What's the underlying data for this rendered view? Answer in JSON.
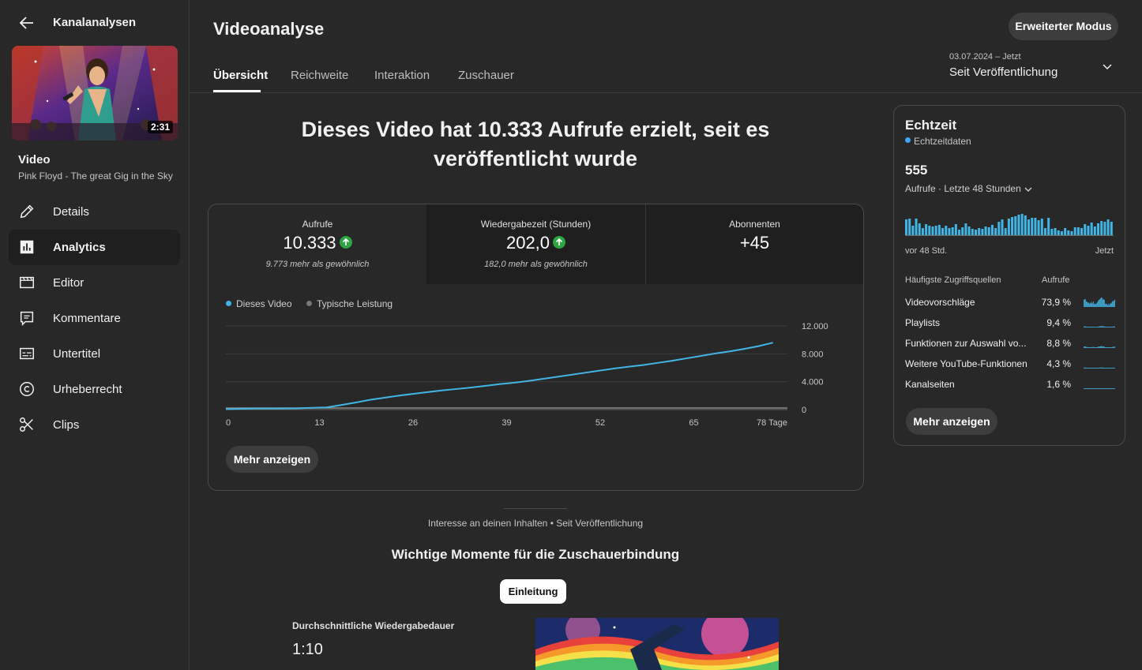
{
  "sidebar": {
    "title": "Kanalanalysen",
    "thumbnail_duration": "2:31",
    "video_label": "Video",
    "video_name": "Pink Floyd - The great Gig in the Sky ...",
    "items": [
      {
        "label": "Details",
        "icon": "pencil-icon"
      },
      {
        "label": "Analytics",
        "icon": "analytics-icon"
      },
      {
        "label": "Editor",
        "icon": "clapperboard-icon"
      },
      {
        "label": "Kommentare",
        "icon": "comment-icon"
      },
      {
        "label": "Untertitel",
        "icon": "subtitles-icon"
      },
      {
        "label": "Urheberrecht",
        "icon": "copyright-icon"
      },
      {
        "label": "Clips",
        "icon": "scissors-icon"
      }
    ]
  },
  "header": {
    "title": "Videoanalyse",
    "advanced_button": "Erweiterter Modus",
    "tabs": [
      "Übersicht",
      "Reichweite",
      "Interaktion",
      "Zuschauer"
    ],
    "date_range": "03.07.2024 – Jetzt",
    "date_label": "Seit Veröffentlichung"
  },
  "headline": "Dieses Video hat 10.333 Aufrufe erzielt, seit es veröffentlicht wurde",
  "metrics": [
    {
      "label": "Aufrufe",
      "value": "10.333",
      "sub": "9.773 mehr als gewöhnlich"
    },
    {
      "label": "Wiedergabezeit (Stunden)",
      "value": "202,0",
      "sub": "182,0 mehr als gewöhnlich"
    },
    {
      "label": "Abonnenten",
      "value": "+45",
      "sub": ""
    }
  ],
  "chart_data": {
    "type": "line",
    "x_tick_labels": [
      "0",
      "13",
      "26",
      "39",
      "52",
      "65",
      "78 Tage"
    ],
    "x_ticks": [
      0,
      13,
      26,
      39,
      52,
      65,
      78
    ],
    "y_ticks": [
      0,
      4000,
      8000,
      12000
    ],
    "y_tick_labels": [
      "0",
      "4.000",
      "8.000",
      "12.000"
    ],
    "ylim": [
      0,
      12000
    ],
    "xlim": [
      0,
      78
    ],
    "series": [
      {
        "name": "Dieses Video",
        "color": "#41b6e6",
        "x": [
          0,
          2,
          4,
          6,
          8,
          10,
          12,
          14,
          16,
          18,
          20,
          22,
          24,
          26,
          28,
          30,
          32,
          34,
          36,
          38,
          40,
          42,
          44,
          46,
          48,
          50,
          52,
          54,
          56,
          58,
          60,
          62,
          64,
          66,
          68,
          70,
          72,
          74,
          76
        ],
        "y": [
          50,
          120,
          150,
          160,
          170,
          190,
          260,
          310,
          650,
          1000,
          1400,
          1700,
          2000,
          2250,
          2500,
          2750,
          2950,
          3150,
          3400,
          3650,
          3850,
          4100,
          4400,
          4700,
          5000,
          5300,
          5600,
          5900,
          6150,
          6400,
          6700,
          7000,
          7350,
          7700,
          8050,
          8350,
          8700,
          9100,
          9600
        ]
      },
      {
        "name": "Typische Leistung",
        "color": "#888888",
        "x": [
          0,
          78
        ],
        "y": [
          0,
          0
        ]
      }
    ]
  },
  "more_button": "Mehr anzeigen",
  "realtime": {
    "title": "Echtzeit",
    "subtitle": "Echtzeitdaten",
    "number": "555",
    "metric": "Aufrufe · Letzte 48 Stunden",
    "left_label": "vor 48 Std.",
    "right_label": "Jetzt",
    "bars": [
      20,
      21,
      12,
      21,
      15,
      9,
      14,
      12,
      11,
      12,
      13,
      9,
      12,
      9,
      10,
      14,
      7,
      10,
      15,
      11,
      8,
      7,
      9,
      8,
      11,
      10,
      13,
      9,
      17,
      20,
      9,
      21,
      23,
      24,
      26,
      27,
      25,
      20,
      22,
      22,
      19,
      21,
      9,
      22,
      8,
      9,
      6,
      5,
      9,
      6,
      5,
      10,
      10,
      9,
      14,
      12,
      16,
      11,
      15,
      18,
      17,
      20,
      17
    ],
    "sources_header": "Häufigste Zugriffsquellen",
    "sources_col": "Aufrufe",
    "sources": [
      {
        "name": "Videovorschläge",
        "pct": "73,9 %"
      },
      {
        "name": "Playlists",
        "pct": "9,4 %"
      },
      {
        "name": "Funktionen zur Auswahl vo...",
        "pct": "8,8 %"
      },
      {
        "name": "Weitere YouTube-Funktionen",
        "pct": "4,3 %"
      },
      {
        "name": "Kanalseiten",
        "pct": "1,6 %"
      }
    ],
    "more_button": "Mehr anzeigen"
  },
  "bottom": {
    "interest": "Interesse an deinen Inhalten • Seit Veröffentlichung",
    "moments": "Wichtige Momente für die Zuschauerbindung",
    "chip": "Einleitung",
    "avg_label": "Durchschnittliche Wiedergabedauer",
    "avg_value": "1:10"
  },
  "colors": {
    "accent": "#3ea6ff",
    "line": "#41b6e6",
    "up": "#2ba640"
  }
}
